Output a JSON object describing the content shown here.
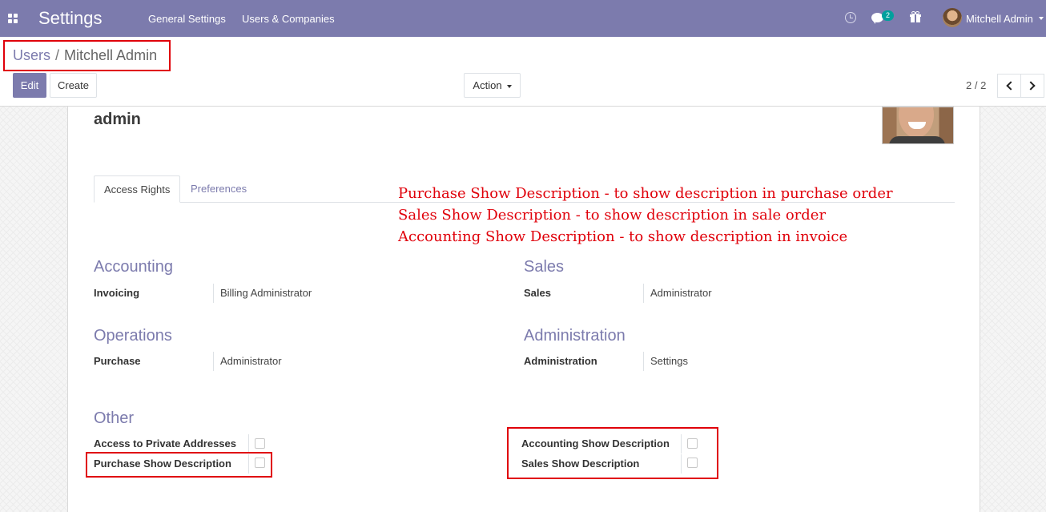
{
  "navbar": {
    "app_title": "Settings",
    "menu": [
      "General Settings",
      "Users & Companies"
    ],
    "messages_badge": "2",
    "user_name": "Mitchell Admin",
    "accent_color": "#7c7bad"
  },
  "breadcrumb": {
    "parent": "Users",
    "separator": "/",
    "current": "Mitchell Admin"
  },
  "toolbar": {
    "edit_label": "Edit",
    "create_label": "Create",
    "action_label": "Action",
    "pager_value": "2 / 2"
  },
  "record": {
    "name": "admin"
  },
  "tabs": [
    "Access Rights",
    "Preferences"
  ],
  "annotations": [
    "Purchase Show Description - to show description in purchase order",
    "Sales Show Description - to show description in sale order",
    "Accounting Show Description - to show description in invoice"
  ],
  "groups": {
    "accounting": {
      "title": "Accounting",
      "label": "Invoicing",
      "value": "Billing Administrator"
    },
    "sales": {
      "title": "Sales",
      "label": "Sales",
      "value": "Administrator"
    },
    "operations": {
      "title": "Operations",
      "label": "Purchase",
      "value": "Administrator"
    },
    "administration": {
      "title": "Administration",
      "label": "Administration",
      "value": "Settings"
    },
    "other": {
      "title": "Other",
      "fields": [
        {
          "label": "Access to Private Addresses",
          "checked": false
        },
        {
          "label": "Purchase Show Description",
          "checked": false
        },
        {
          "label": "Accounting Show Description",
          "checked": false
        },
        {
          "label": "Sales Show Description",
          "checked": false
        }
      ]
    }
  },
  "highlight_color": "#e0000a"
}
